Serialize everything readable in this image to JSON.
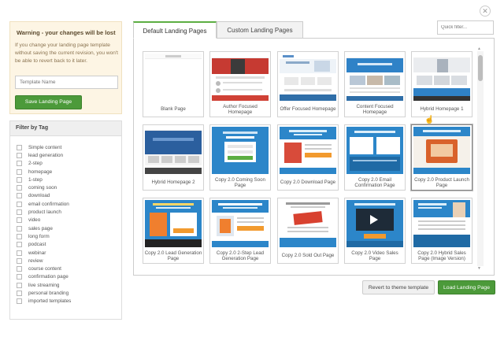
{
  "warning": {
    "title": "Warning - your changes will be lost",
    "text": "If you change your landing page template without saving the current revision, you won't be able to revert back to it later.",
    "template_name_placeholder": "Template Name",
    "save_button": "Save Landing Page"
  },
  "filter": {
    "title": "Filter by Tag",
    "tags": [
      "Simple content",
      "lead generation",
      "2-step",
      "homepage",
      "1-step",
      "coming soon",
      "download",
      "email confirmation",
      "product launch",
      "video",
      "sales page",
      "long form",
      "podcast",
      "webinar",
      "review",
      "course content",
      "confirmation page",
      "live streaming",
      "personal branding",
      "imported templates"
    ]
  },
  "tabs": [
    "Default Landing Pages",
    "Custom Landing Pages"
  ],
  "quick_filter_placeholder": "Quick filter...",
  "templates": [
    "Blank Page",
    "Author Focused Homepage",
    "Offer Focused Homepage",
    "Content Focused Homepage",
    "Hybrid Homepage 1",
    "Hybrid Homepage 2",
    "Copy 2.0 Coming Soon Page",
    "Copy 2.0 Download Page",
    "Copy 2.0 Email Confirmation Page",
    "Copy 2.0 Product Launch Page",
    "Copy 2.0 Lead Generation Page",
    "Copy 2.0 2-Step Lead Generation Page",
    "Copy 2.0 Sold Out Page",
    "Copy 2.0 Video Sales Page",
    "Copy 2.0 Hybrid Sales Page (Image Version)"
  ],
  "buttons": {
    "revert": "Revert to theme template",
    "load": "Load Landing Page"
  },
  "colors": {
    "accent_green": "#4c9a3a",
    "brand_blue": "#2b7fc4",
    "warning_bg": "#fdf5e4"
  }
}
